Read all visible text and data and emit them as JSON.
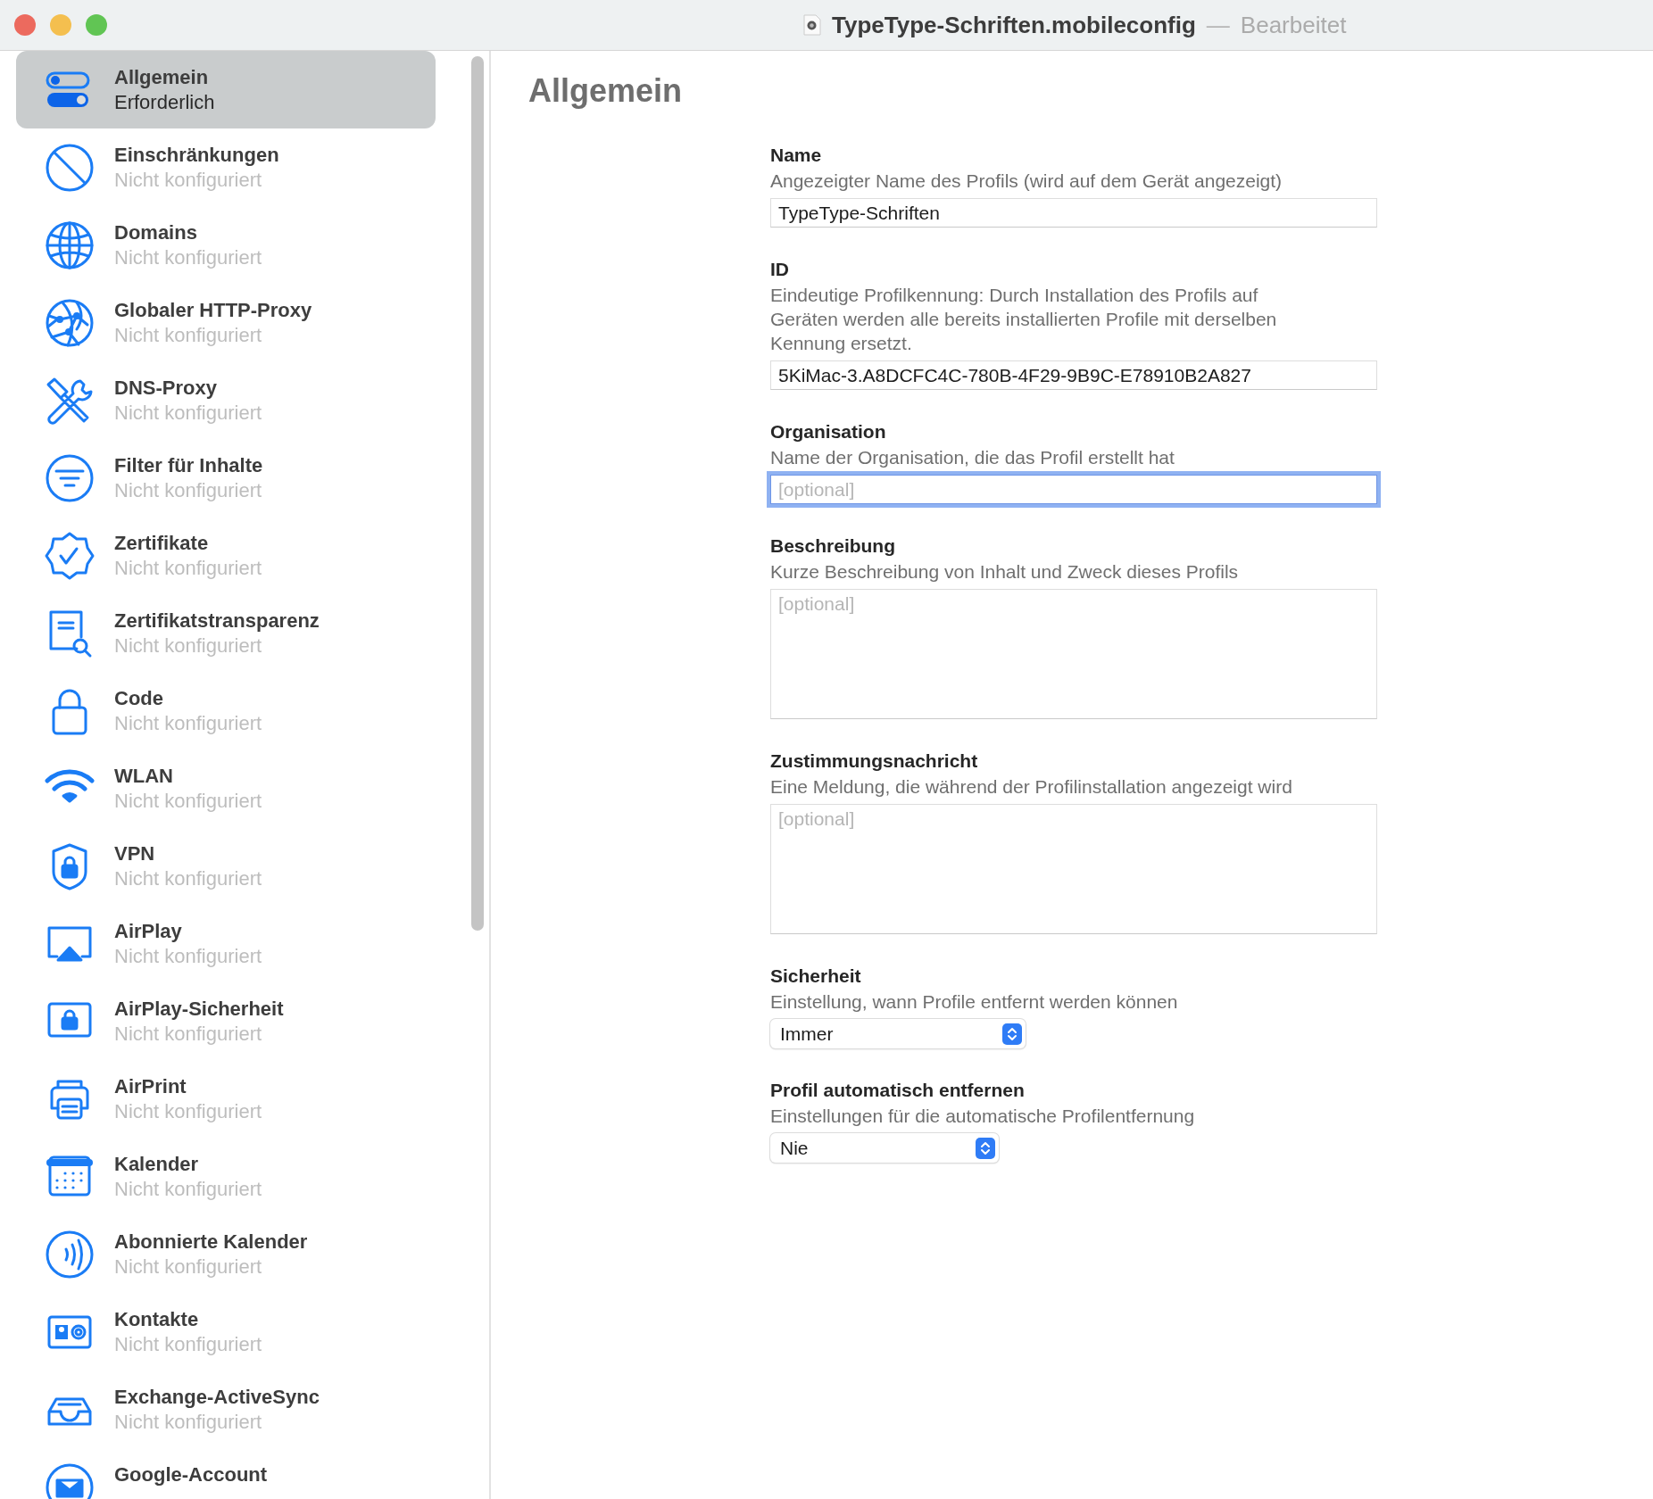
{
  "window": {
    "title": "TypeType-Schriften.mobileconfig",
    "separator": "—",
    "state": "Bearbeitet"
  },
  "sidebar": {
    "items": [
      {
        "kind": "toggles",
        "title": "Allgemein",
        "status": "Erforderlich",
        "selected": true
      },
      {
        "kind": "prohibited",
        "title": "Einschränkungen",
        "status": "Nicht konfiguriert",
        "selected": false
      },
      {
        "kind": "globe",
        "title": "Domains",
        "status": "Nicht konfiguriert",
        "selected": false
      },
      {
        "kind": "network-globe",
        "title": "Globaler HTTP-Proxy",
        "status": "Nicht konfiguriert",
        "selected": false
      },
      {
        "kind": "tools",
        "title": "DNS-Proxy",
        "status": "Nicht konfiguriert",
        "selected": false
      },
      {
        "kind": "filter",
        "title": "Filter für Inhalte",
        "status": "Nicht konfiguriert",
        "selected": false
      },
      {
        "kind": "seal",
        "title": "Zertifikate",
        "status": "Nicht konfiguriert",
        "selected": false
      },
      {
        "kind": "doc-search",
        "title": "Zertifikatstransparenz",
        "status": "Nicht konfiguriert",
        "selected": false
      },
      {
        "kind": "lock",
        "title": "Code",
        "status": "Nicht konfiguriert",
        "selected": false
      },
      {
        "kind": "wifi",
        "title": "WLAN",
        "status": "Nicht konfiguriert",
        "selected": false
      },
      {
        "kind": "shield",
        "title": "VPN",
        "status": "Nicht konfiguriert",
        "selected": false
      },
      {
        "kind": "airplay",
        "title": "AirPlay",
        "status": "Nicht konfiguriert",
        "selected": false
      },
      {
        "kind": "screen-lock",
        "title": "AirPlay-Sicherheit",
        "status": "Nicht konfiguriert",
        "selected": false
      },
      {
        "kind": "printer",
        "title": "AirPrint",
        "status": "Nicht konfiguriert",
        "selected": false
      },
      {
        "kind": "calendar",
        "title": "Kalender",
        "status": "Nicht konfiguriert",
        "selected": false
      },
      {
        "kind": "broadcast",
        "title": "Abonnierte Kalender",
        "status": "Nicht konfiguriert",
        "selected": false
      },
      {
        "kind": "contact",
        "title": "Kontakte",
        "status": "Nicht konfiguriert",
        "selected": false
      },
      {
        "kind": "tray",
        "title": "Exchange-ActiveSync",
        "status": "Nicht konfiguriert",
        "selected": false
      },
      {
        "kind": "mail",
        "title": "Google-Account",
        "selected": false
      }
    ]
  },
  "main": {
    "heading": "Allgemein",
    "fields": [
      {
        "kind": "text",
        "label": "Name",
        "description": "Angezeigter Name des Profils (wird auf dem Gerät angezeigt)",
        "value": "TypeType-Schriften",
        "focused": false
      },
      {
        "kind": "text",
        "label": "ID",
        "description": "Eindeutige Profilkennung: Durch Installation des Profils auf Geräten werden alle bereits installierten Profile mit derselben Kennung ersetzt.",
        "value": "5KiMac-3.A8DCFC4C-780B-4F29-9B9C-E78910B2A827",
        "focused": false
      },
      {
        "kind": "text",
        "label": "Organisation",
        "description": "Name der Organisation, die das Profil erstellt hat",
        "placeholder": "[optional]",
        "focused": true
      },
      {
        "kind": "textarea",
        "label": "Beschreibung",
        "description": "Kurze Beschreibung von Inhalt und Zweck dieses Profils",
        "placeholder": "[optional]",
        "focused": false
      },
      {
        "kind": "textarea",
        "label": "Zustimmungsnachricht",
        "description": "Eine Meldung, die während der Profilinstallation angezeigt wird",
        "placeholder": "[optional]",
        "focused": false
      },
      {
        "kind": "select",
        "label": "Sicherheit",
        "description": "Einstellung, wann Profile entfernt werden können",
        "value": "Immer",
        "focused": false
      },
      {
        "kind": "select",
        "label": "Profil automatisch entfernen",
        "description": "Einstellungen für die automatische Profilentfernung",
        "value": "Nie",
        "focused": false
      }
    ]
  }
}
